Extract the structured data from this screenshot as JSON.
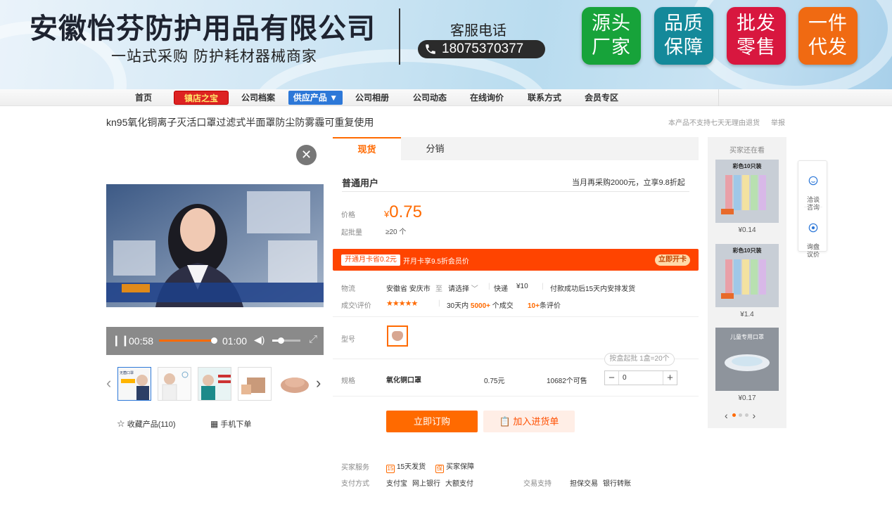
{
  "banner": {
    "company_name": "安徽怡芬防护用品有限公司",
    "slogan": "一站式采购 防护耗材器械商家",
    "hotline_label": "客服电话",
    "hotline_number": "18075370377",
    "badges": [
      {
        "line1": "源头",
        "line2": "厂家",
        "color": "#17a33a"
      },
      {
        "line1": "品质",
        "line2": "保障",
        "color": "#14899a"
      },
      {
        "line1": "批发",
        "line2": "零售",
        "color": "#d8173f"
      },
      {
        "line1": "一件",
        "line2": "代发",
        "color": "#f06a12"
      }
    ]
  },
  "nav": {
    "home": "首页",
    "treasure": "镇店之宝",
    "profile": "公司档案",
    "supply": "供应产品 ▼",
    "album": "公司相册",
    "news": "公司动态",
    "inquiry": "在线询价",
    "contact": "联系方式",
    "member": "会员专区"
  },
  "product": {
    "title": "kn95氧化铜离子灭活口罩过滤式半面罩防尘防雾霾可重复使用",
    "return_note": "本产品不支持七天无理由退货",
    "report": "举报"
  },
  "video": {
    "current_time": "00:58",
    "duration": "01:00",
    "progress": 0.97,
    "volume": 0.3
  },
  "gallery": {
    "thumb_caption_1": "无菌口罩",
    "favorite_label": "收藏产品(110)",
    "mobile_order": "手机下单"
  },
  "tabs": {
    "spot": "现货",
    "distribution": "分销"
  },
  "pricing": {
    "user_type": "普通用户",
    "promo": "当月再采购2000元，立享9.8折起",
    "price_label": "价格",
    "currency": "¥",
    "price": "0.75",
    "min_label": "起批量",
    "min_qty": "≥20 个"
  },
  "vip": {
    "tag": "开通月卡省0.2元",
    "text": "开月卡享9.5折会员价",
    "button": "立即开卡"
  },
  "logistics": {
    "label": "物流",
    "origin": "安徽省 安庆市",
    "to": "至",
    "dest": "请选择",
    "express": "快递",
    "fee": "¥10",
    "ship_note": "付款成功后15天内安排发货"
  },
  "deals": {
    "label": "成交\\评价",
    "stars": "★★★★★",
    "in_30_days": "30天内",
    "count": "5000+",
    "count_unit": "个成交",
    "reviews": "10+",
    "reviews_unit": "条评价"
  },
  "model": {
    "label": "型号"
  },
  "spec": {
    "label": "规格",
    "name": "氧化铜口罩",
    "unit_price": "0.75元",
    "stock": "10682个可售",
    "pack_note": "按盒起批 1盒=20个",
    "qty": "0"
  },
  "actions": {
    "order": "立即订购",
    "cart": "加入进货单"
  },
  "services": {
    "label": "买家服务",
    "ship15": "15天发货",
    "ship15_icon": "15",
    "guarantee": "买家保障",
    "guarantee_icon": "保",
    "pay_label": "支付方式",
    "pay_methods": [
      "支付宝",
      "网上银行",
      "大额支付"
    ],
    "trade_label": "交易支持",
    "trade_methods": [
      "担保交易",
      "银行转账"
    ]
  },
  "recommend": {
    "title": "买家还在看",
    "items": [
      {
        "caption": "彩色10只装",
        "price": "¥0.14"
      },
      {
        "caption": "彩色10只装",
        "price": "¥1.4"
      },
      {
        "caption": "儿童专用口罩",
        "price": "¥0.17"
      }
    ]
  },
  "float_bar": {
    "chat": "洽谈\n咨询",
    "quote": "询盘\n议价"
  }
}
